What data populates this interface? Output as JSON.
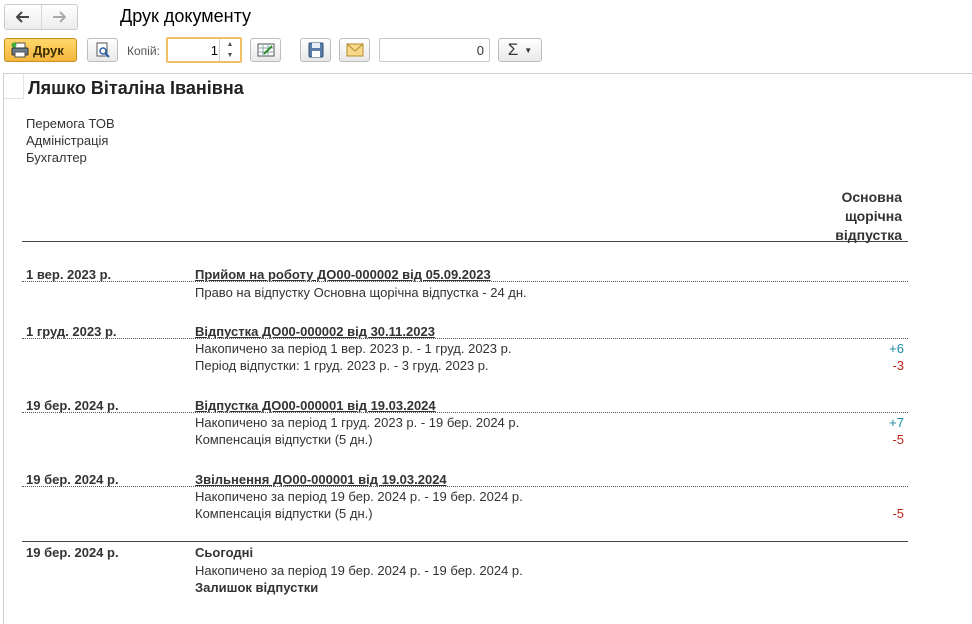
{
  "window": {
    "title": "Друк документу"
  },
  "toolbar": {
    "print_label": "Друк",
    "copies_label": "Копій:",
    "copies_value": "1",
    "number_value": "0",
    "sum_symbol": "Σ"
  },
  "document": {
    "employee": "Ляшко Віталіна Іванівна",
    "company": "Перемога ТОВ",
    "department": "Адміністрація",
    "position": "Бухгалтер",
    "column_header": [
      "Основна",
      "щорічна",
      "відпустка"
    ],
    "entries": [
      {
        "date": "1 вер. 2023 р.",
        "event": "Прийом на роботу ДО00-000002 від 05.09.2023",
        "lines": [
          {
            "text": "Право на відпустку Основна щорічна відпустка - 24 дн.",
            "value": ""
          }
        ]
      },
      {
        "date": "1 груд. 2023 р.",
        "event": "Відпустка ДО00-000002 від 30.11.2023",
        "lines": [
          {
            "text": "Накопичено за період 1 вер. 2023 р. - 1 груд. 2023 р.",
            "value": "+6"
          },
          {
            "text": "Період відпустки: 1 груд. 2023 р. - 3 груд. 2023 р.",
            "value": "-3"
          }
        ]
      },
      {
        "date": "19 бер. 2024 р.",
        "event": "Відпустка ДО00-000001 від 19.03.2024",
        "lines": [
          {
            "text": "Накопичено за період 1 груд. 2023 р. - 19 бер. 2024 р.",
            "value": "+7"
          },
          {
            "text": "Компенсація відпустки (5 дн.)",
            "value": "-5"
          }
        ]
      },
      {
        "date": "19 бер. 2024 р.",
        "event": "Звільнення ДО00-000001 від 19.03.2024",
        "lines": [
          {
            "text": "Накопичено за період 19 бер. 2024 р. - 19 бер. 2024 р.",
            "value": ""
          },
          {
            "text": "Компенсація відпустки (5 дн.)",
            "value": "-5"
          }
        ]
      }
    ],
    "today": {
      "date": "19 бер. 2024 р.",
      "label": "Сьогодні",
      "accrued": "Накопичено за період 19 бер. 2024 р. - 19 бер. 2024 р.",
      "balance_label": "Залишок відпустки"
    }
  },
  "colors": {
    "positive": "#1a8aa5",
    "negative": "#c0271b",
    "print_button": "#f3b63c"
  }
}
